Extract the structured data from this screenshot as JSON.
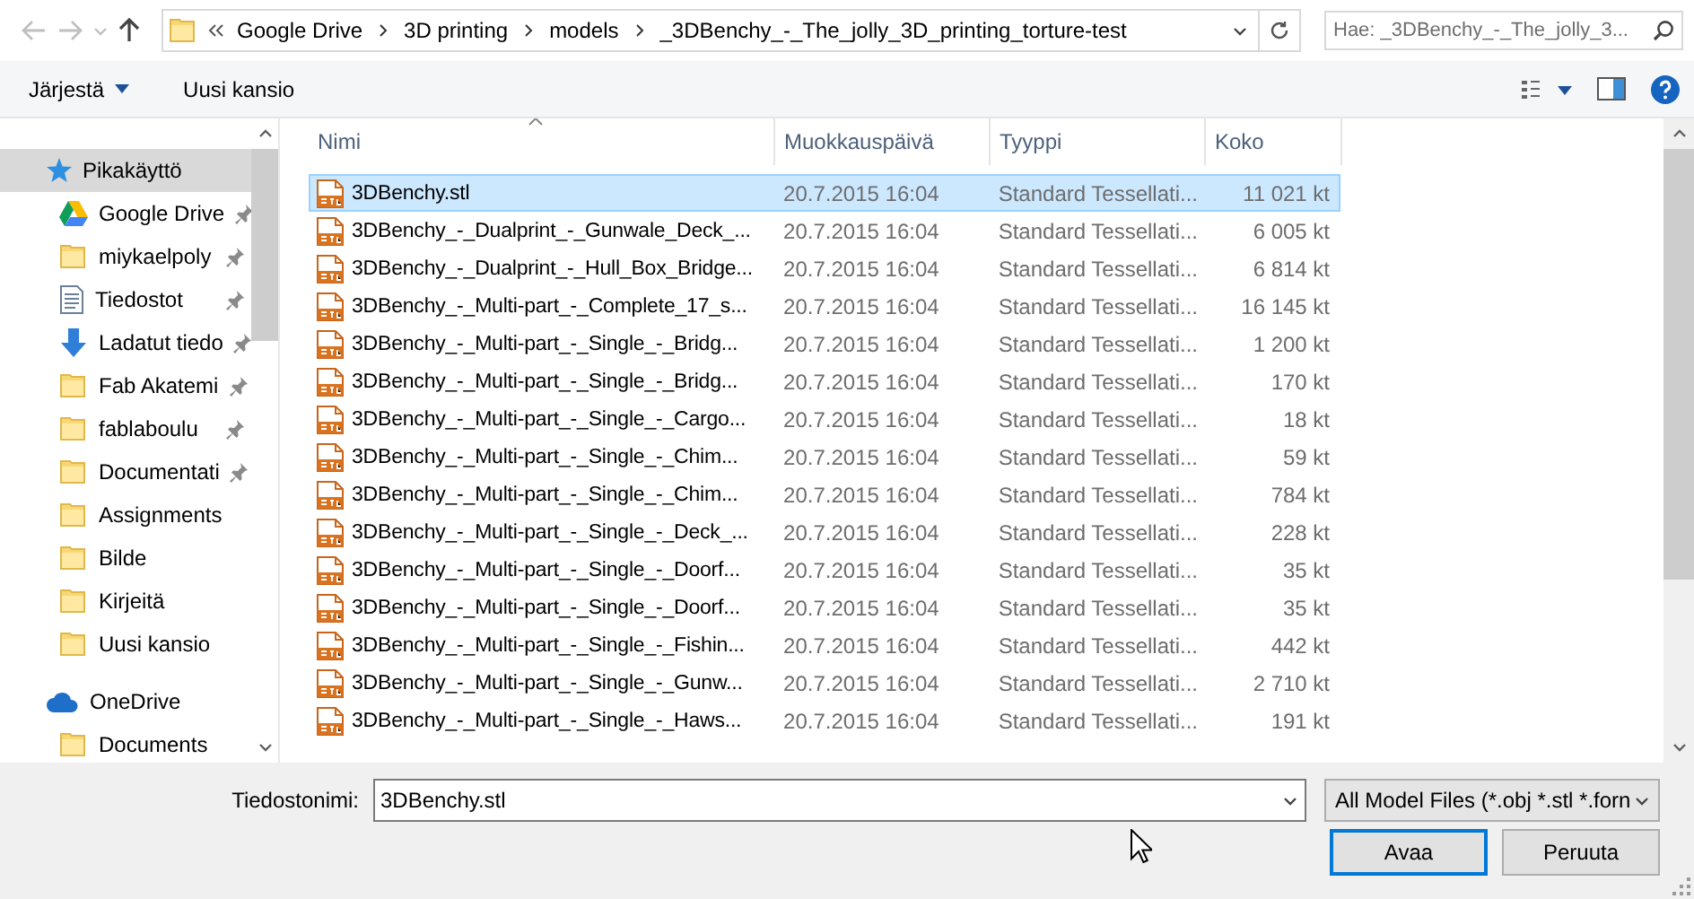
{
  "address": {
    "path": [
      "Google Drive",
      "3D printing",
      "models",
      "_3DBenchy_-_The_jolly_3D_printing_torture-test"
    ]
  },
  "search": {
    "placeholder": "Hae: _3DBenchy_-_The_jolly_3..."
  },
  "toolbar": {
    "organize": "Järjestä",
    "new_folder": "Uusi kansio"
  },
  "sidebar": {
    "items": [
      {
        "label": "Pikakäyttö",
        "kind": "quick",
        "selected": true,
        "children": [
          {
            "label": "Google Drive",
            "kind": "drive",
            "pinned": true,
            "selected": false
          },
          {
            "label": "miykaelpoly",
            "kind": "folder",
            "pinned": true,
            "selected": false
          },
          {
            "label": "Tiedostot",
            "kind": "document",
            "pinned": true,
            "selected": false
          },
          {
            "label": "Ladatut tiedo",
            "kind": "download",
            "pinned": true,
            "selected": false
          },
          {
            "label": "Fab Akatemi",
            "kind": "folder",
            "pinned": true,
            "selected": false
          },
          {
            "label": "fablaboulu",
            "kind": "folder",
            "pinned": true,
            "selected": false
          },
          {
            "label": "Documentati",
            "kind": "folder",
            "pinned": true,
            "selected": false
          },
          {
            "label": "Assignments",
            "kind": "folder",
            "pinned": false,
            "selected": false
          },
          {
            "label": "Bilde",
            "kind": "folder",
            "pinned": false,
            "selected": false
          },
          {
            "label": "Kirjeitä",
            "kind": "folder",
            "pinned": false,
            "selected": false
          },
          {
            "label": "Uusi kansio",
            "kind": "folder",
            "pinned": false,
            "selected": false
          }
        ]
      },
      {
        "label": "OneDrive",
        "kind": "cloud",
        "selected": false,
        "children": [
          {
            "label": "Documents",
            "kind": "folder",
            "pinned": false,
            "selected": false
          }
        ]
      }
    ]
  },
  "file_list": {
    "columns": [
      {
        "label": "Nimi",
        "sorted": true
      },
      {
        "label": "Muokkauspäivä",
        "sorted": false
      },
      {
        "label": "Tyyppi",
        "sorted": false
      },
      {
        "label": "Koko",
        "sorted": false
      }
    ],
    "rows": [
      {
        "name": "3DBenchy.stl",
        "modified": "20.7.2015 16:04",
        "type": "Standard Tessellati...",
        "size": "11 021 kt",
        "selected": true
      },
      {
        "name": "3DBenchy_-_Dualprint_-_Gunwale_Deck_...",
        "modified": "20.7.2015 16:04",
        "type": "Standard Tessellati...",
        "size": "6 005 kt",
        "selected": false
      },
      {
        "name": "3DBenchy_-_Dualprint_-_Hull_Box_Bridge...",
        "modified": "20.7.2015 16:04",
        "type": "Standard Tessellati...",
        "size": "6 814 kt",
        "selected": false
      },
      {
        "name": "3DBenchy_-_Multi-part_-_Complete_17_s...",
        "modified": "20.7.2015 16:04",
        "type": "Standard Tessellati...",
        "size": "16 145 kt",
        "selected": false
      },
      {
        "name": "3DBenchy_-_Multi-part_-_Single_-_Bridg...",
        "modified": "20.7.2015 16:04",
        "type": "Standard Tessellati...",
        "size": "1 200 kt",
        "selected": false
      },
      {
        "name": "3DBenchy_-_Multi-part_-_Single_-_Bridg...",
        "modified": "20.7.2015 16:04",
        "type": "Standard Tessellati...",
        "size": "170 kt",
        "selected": false
      },
      {
        "name": "3DBenchy_-_Multi-part_-_Single_-_Cargo...",
        "modified": "20.7.2015 16:04",
        "type": "Standard Tessellati...",
        "size": "18 kt",
        "selected": false
      },
      {
        "name": "3DBenchy_-_Multi-part_-_Single_-_Chim...",
        "modified": "20.7.2015 16:04",
        "type": "Standard Tessellati...",
        "size": "59 kt",
        "selected": false
      },
      {
        "name": "3DBenchy_-_Multi-part_-_Single_-_Chim...",
        "modified": "20.7.2015 16:04",
        "type": "Standard Tessellati...",
        "size": "784 kt",
        "selected": false
      },
      {
        "name": "3DBenchy_-_Multi-part_-_Single_-_Deck_...",
        "modified": "20.7.2015 16:04",
        "type": "Standard Tessellati...",
        "size": "228 kt",
        "selected": false
      },
      {
        "name": "3DBenchy_-_Multi-part_-_Single_-_Doorf...",
        "modified": "20.7.2015 16:04",
        "type": "Standard Tessellati...",
        "size": "35 kt",
        "selected": false
      },
      {
        "name": "3DBenchy_-_Multi-part_-_Single_-_Doorf...",
        "modified": "20.7.2015 16:04",
        "type": "Standard Tessellati...",
        "size": "35 kt",
        "selected": false
      },
      {
        "name": "3DBenchy_-_Multi-part_-_Single_-_Fishin...",
        "modified": "20.7.2015 16:04",
        "type": "Standard Tessellati...",
        "size": "442 kt",
        "selected": false
      },
      {
        "name": "3DBenchy_-_Multi-part_-_Single_-_Gunw...",
        "modified": "20.7.2015 16:04",
        "type": "Standard Tessellati...",
        "size": "2 710 kt",
        "selected": false
      },
      {
        "name": "3DBenchy_-_Multi-part_-_Single_-_Haws...",
        "modified": "20.7.2015 16:04",
        "type": "Standard Tessellati...",
        "size": "191 kt",
        "selected": false
      }
    ]
  },
  "footer": {
    "filename_label": "Tiedostonimi:",
    "filename": "3DBenchy.stl",
    "file_type": "All Model Files (*.obj *.stl *.forn",
    "buttons": [
      {
        "label": "Avaa",
        "default": true
      },
      {
        "label": "Peruuta",
        "default": false
      }
    ]
  }
}
